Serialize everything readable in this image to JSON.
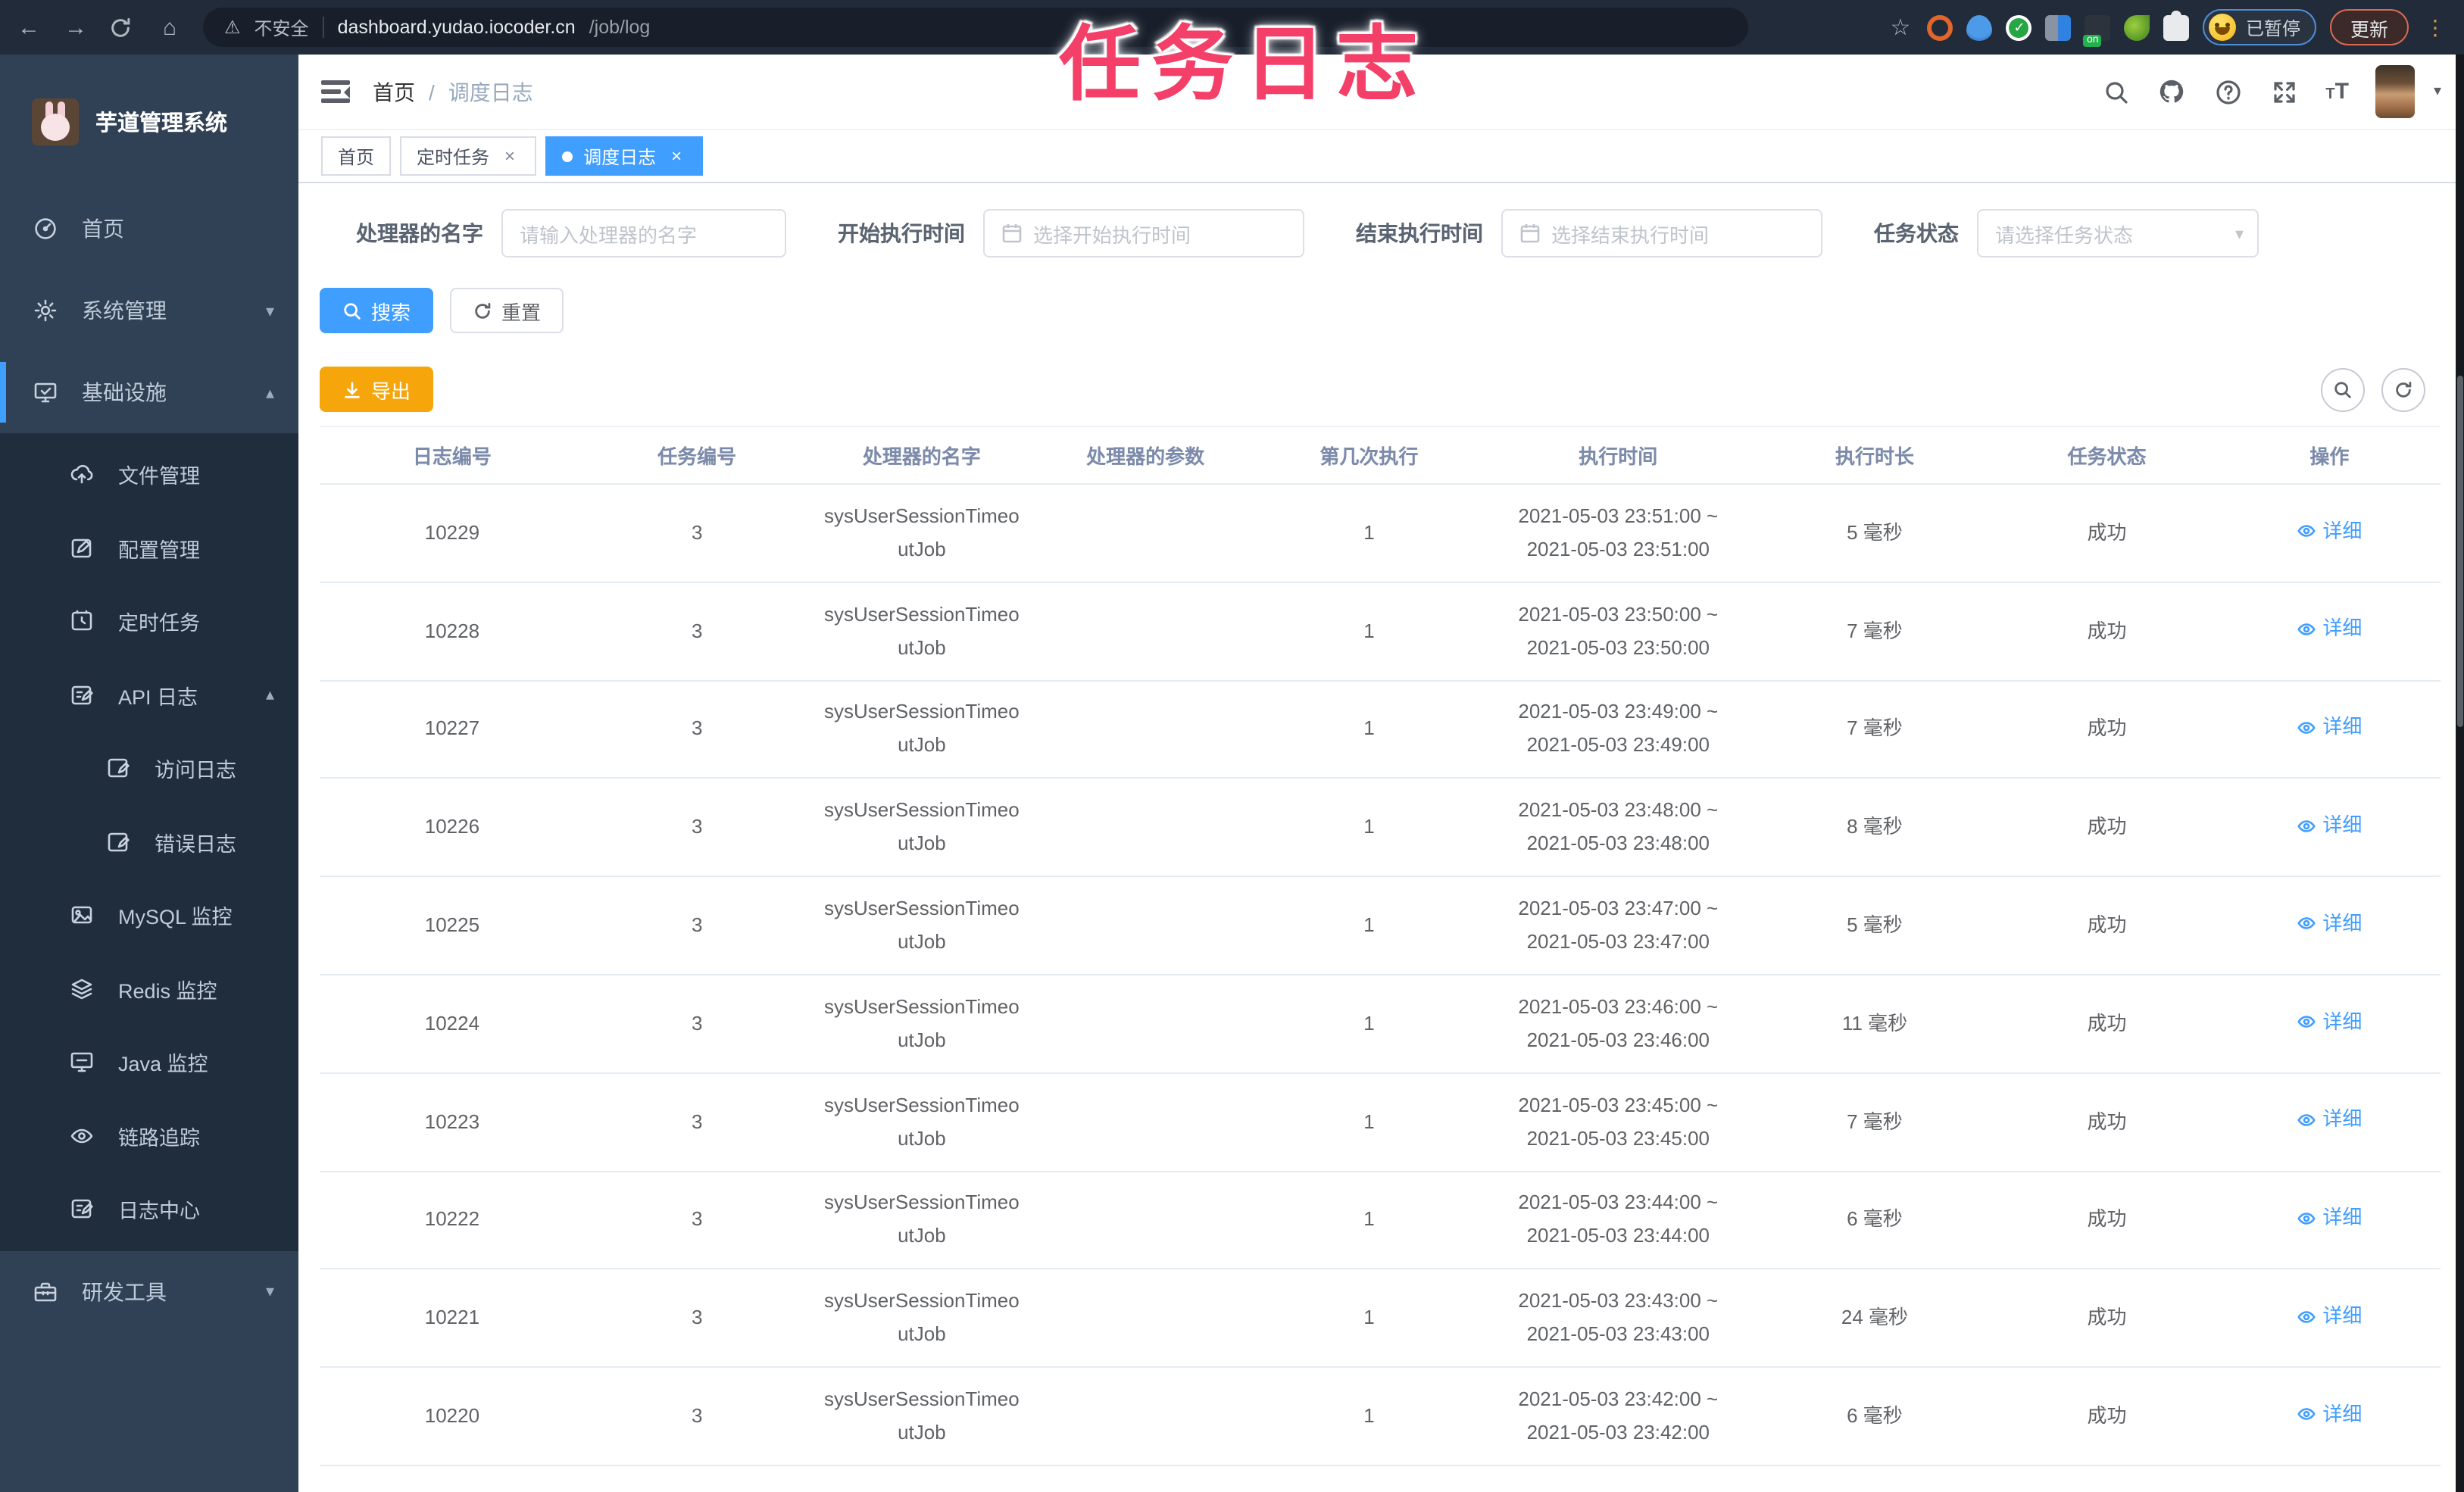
{
  "browser": {
    "security_label": "不安全",
    "url_host": "dashboard.yudao.iocoder.cn",
    "url_path": "/job/log",
    "paused_chip": "已暂停",
    "update_button": "更新"
  },
  "icons": {
    "back": "←",
    "forward": "→",
    "home": "⌂",
    "warning": "⚠",
    "star": "☆",
    "dots": "⋮",
    "slash": "/",
    "chevron_down": "▾",
    "chevron_up": "▴",
    "caret_down": "▾",
    "close": "×"
  },
  "overlay_title": "任务日志",
  "sidebar": {
    "title": "芋道管理系统",
    "menu": [
      {
        "label": "首页"
      },
      {
        "label": "系统管理"
      },
      {
        "label": "基础设施"
      },
      {
        "label": "研发工具"
      }
    ],
    "submenu": [
      {
        "label": "文件管理"
      },
      {
        "label": "配置管理"
      },
      {
        "label": "定时任务"
      },
      {
        "label": "API 日志"
      },
      {
        "label": "访问日志"
      },
      {
        "label": "错误日志"
      },
      {
        "label": "MySQL 监控"
      },
      {
        "label": "Redis 监控"
      },
      {
        "label": "Java 监控"
      },
      {
        "label": "链路追踪"
      },
      {
        "label": "日志中心"
      }
    ]
  },
  "header": {
    "breadcrumb_home": "首页",
    "breadcrumb_current": "调度日志"
  },
  "tabs": [
    {
      "label": "首页"
    },
    {
      "label": "定时任务"
    },
    {
      "label": "调度日志"
    }
  ],
  "filters": {
    "handler_label": "处理器的名字",
    "handler_placeholder": "请输入处理器的名字",
    "start_label": "开始执行时间",
    "start_placeholder": "选择开始执行时间",
    "end_label": "结束执行时间",
    "end_placeholder": "选择结束执行时间",
    "status_label": "任务状态",
    "status_placeholder": "请选择任务状态"
  },
  "actions": {
    "search": "搜索",
    "reset": "重置",
    "export": "导出"
  },
  "table": {
    "headers": [
      "日志编号",
      "任务编号",
      "处理器的名字",
      "处理器的参数",
      "第几次执行",
      "执行时间",
      "执行时长",
      "任务状态",
      "操作"
    ],
    "detail_label": "详细",
    "rows": [
      {
        "id": "10229",
        "task_id": "3",
        "handler": "sysUserSessionTimeoutJob",
        "params": "",
        "count": "1",
        "time1": "2021-05-03 23:51:00 ~",
        "time2": "2021-05-03 23:51:00",
        "duration": "5 毫秒",
        "status": "成功"
      },
      {
        "id": "10228",
        "task_id": "3",
        "handler": "sysUserSessionTimeoutJob",
        "params": "",
        "count": "1",
        "time1": "2021-05-03 23:50:00 ~",
        "time2": "2021-05-03 23:50:00",
        "duration": "7 毫秒",
        "status": "成功"
      },
      {
        "id": "10227",
        "task_id": "3",
        "handler": "sysUserSessionTimeoutJob",
        "params": "",
        "count": "1",
        "time1": "2021-05-03 23:49:00 ~",
        "time2": "2021-05-03 23:49:00",
        "duration": "7 毫秒",
        "status": "成功"
      },
      {
        "id": "10226",
        "task_id": "3",
        "handler": "sysUserSessionTimeoutJob",
        "params": "",
        "count": "1",
        "time1": "2021-05-03 23:48:00 ~",
        "time2": "2021-05-03 23:48:00",
        "duration": "8 毫秒",
        "status": "成功"
      },
      {
        "id": "10225",
        "task_id": "3",
        "handler": "sysUserSessionTimeoutJob",
        "params": "",
        "count": "1",
        "time1": "2021-05-03 23:47:00 ~",
        "time2": "2021-05-03 23:47:00",
        "duration": "5 毫秒",
        "status": "成功"
      },
      {
        "id": "10224",
        "task_id": "3",
        "handler": "sysUserSessionTimeoutJob",
        "params": "",
        "count": "1",
        "time1": "2021-05-03 23:46:00 ~",
        "time2": "2021-05-03 23:46:00",
        "duration": "11 毫秒",
        "status": "成功"
      },
      {
        "id": "10223",
        "task_id": "3",
        "handler": "sysUserSessionTimeoutJob",
        "params": "",
        "count": "1",
        "time1": "2021-05-03 23:45:00 ~",
        "time2": "2021-05-03 23:45:00",
        "duration": "7 毫秒",
        "status": "成功"
      },
      {
        "id": "10222",
        "task_id": "3",
        "handler": "sysUserSessionTimeoutJob",
        "params": "",
        "count": "1",
        "time1": "2021-05-03 23:44:00 ~",
        "time2": "2021-05-03 23:44:00",
        "duration": "6 毫秒",
        "status": "成功"
      },
      {
        "id": "10221",
        "task_id": "3",
        "handler": "sysUserSessionTimeoutJob",
        "params": "",
        "count": "1",
        "time1": "2021-05-03 23:43:00 ~",
        "time2": "2021-05-03 23:43:00",
        "duration": "24 毫秒",
        "status": "成功"
      },
      {
        "id": "10220",
        "task_id": "3",
        "handler": "sysUserSessionTimeoutJob",
        "params": "",
        "count": "1",
        "time1": "2021-05-03 23:42:00 ~",
        "time2": "2021-05-03 23:42:00",
        "duration": "6 毫秒",
        "status": "成功"
      }
    ]
  }
}
